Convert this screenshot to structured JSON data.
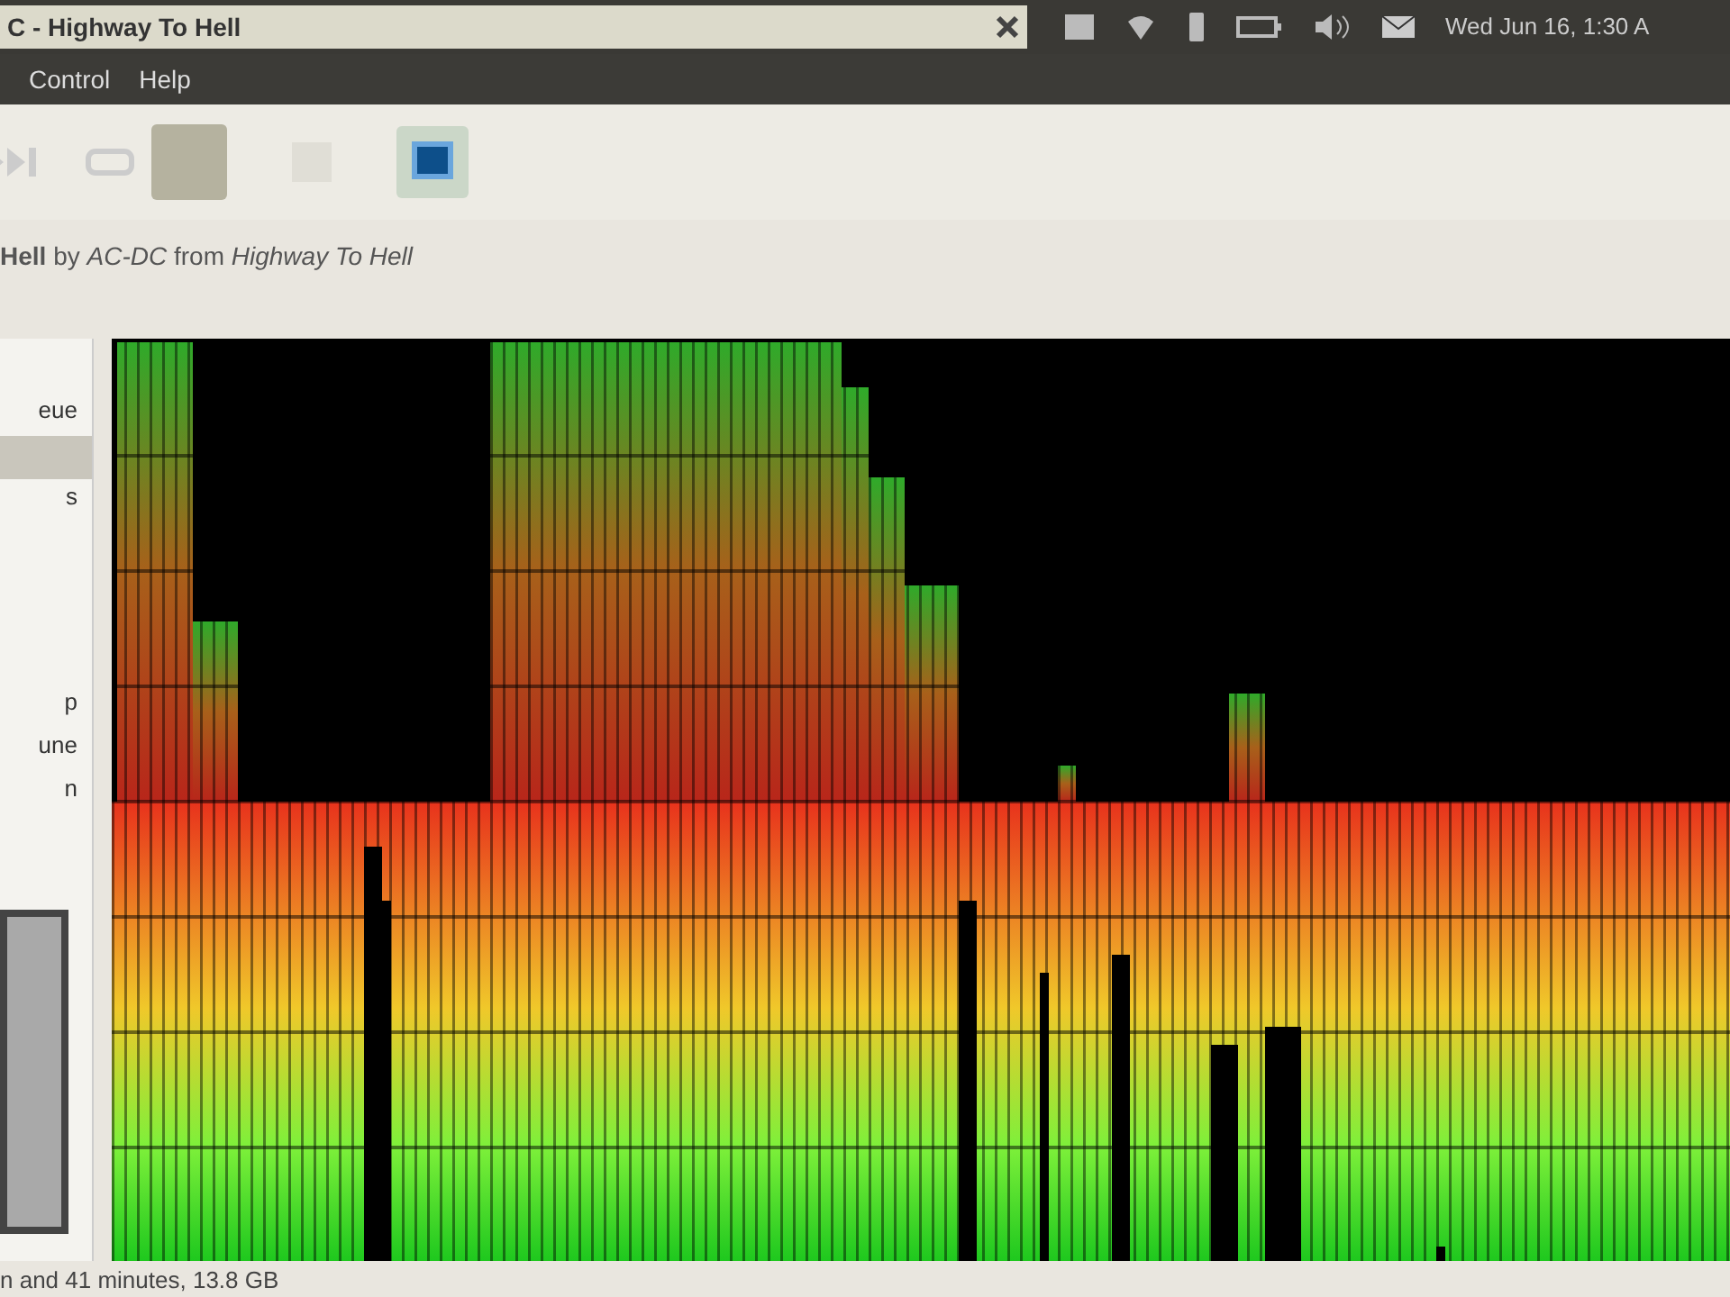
{
  "window": {
    "title": "C - Highway To Hell"
  },
  "panel": {
    "clock": "Wed Jun 16, 1:30 A"
  },
  "menu": [
    "Control",
    "Help"
  ],
  "now_playing": "**Hell** by *AC-DC* from *Highway To Hell*",
  "sidebar": {
    "items": [
      {
        "label": "eue",
        "selected": false
      },
      {
        "selected": true
      },
      {
        "label": "s",
        "selected": false
      },
      {
        "label": "p",
        "selected": false
      },
      {
        "label": "une",
        "selected": false
      },
      {
        "label": "n",
        "selected": false
      }
    ]
  },
  "status_bar": "n and 41 minutes, 13.8 GB"
}
